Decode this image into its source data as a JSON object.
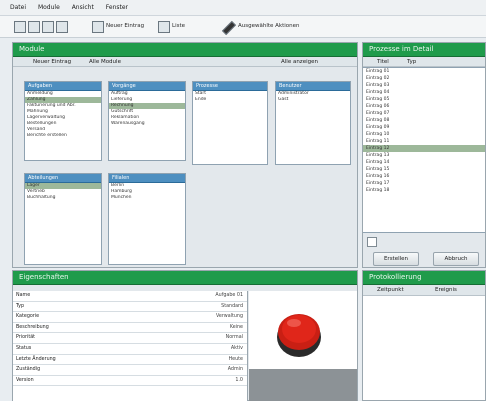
{
  "menu": [
    "Datei",
    "Module",
    "Ansicht",
    "Fenster"
  ],
  "toolbar": {
    "btn1": "Neuer Eintrag",
    "btn2": "Liste",
    "btn3": "Ausgewählte Aktionen"
  },
  "main": {
    "title": "Module",
    "tabs": [
      "Neuer Eintrag",
      "Alle Module",
      "Alle anzeigen"
    ],
    "boxes": [
      {
        "title": "Aufgaben",
        "rows": [
          "Anmeldung",
          "Zahlung",
          "Fakturierung und Abr.",
          "Mahnung",
          "Lagerverwaltung",
          "Bestellungen",
          "Versand",
          "Berichte erstellen"
        ]
      },
      {
        "title": "Vorgänge",
        "rows": [
          "Auftrag",
          "Lieferung",
          "Rechnung",
          "Gutschrift",
          "Reklamation",
          "Warenausgang"
        ]
      },
      {
        "title": "Prozesse",
        "rows": [
          "Start",
          "Ende"
        ]
      },
      {
        "title": "Benutzer",
        "rows": [
          "Administrator",
          "Gast"
        ]
      },
      {
        "title": "Abteilungen",
        "rows": [
          "Lager",
          "Vertrieb",
          "Buchhaltung"
        ]
      },
      {
        "title": "Filialen",
        "rows": [
          "Berlin",
          "Hamburg",
          "München"
        ]
      }
    ]
  },
  "right": {
    "title": "Prozesse im Detail",
    "tabs": [
      "Titel",
      "Typ"
    ],
    "items": [
      "Eintrag 01",
      "Eintrag 02",
      "Eintrag 03",
      "Eintrag 04",
      "Eintrag 05",
      "Eintrag 06",
      "Eintrag 07",
      "Eintrag 08",
      "Eintrag 09",
      "Eintrag 10",
      "Eintrag 11",
      "Eintrag 12",
      "Eintrag 13",
      "Eintrag 14",
      "Eintrag 15",
      "Eintrag 16",
      "Eintrag 17",
      "Eintrag 18"
    ],
    "btn_ok": "Erstellen",
    "btn_cancel": "Abbruch"
  },
  "bottom": {
    "title": "Eigenschaften",
    "rows": [
      {
        "label": "Name",
        "value": "Aufgabe 01"
      },
      {
        "label": "Typ",
        "value": "Standard"
      },
      {
        "label": "Kategorie",
        "value": "Verwaltung"
      },
      {
        "label": "Beschreibung",
        "value": "Keine"
      },
      {
        "label": "Priorität",
        "value": "Normal"
      },
      {
        "label": "Status",
        "value": "Aktiv"
      },
      {
        "label": "Letzte Änderung",
        "value": "Heute"
      },
      {
        "label": "Zuständig",
        "value": "Admin"
      },
      {
        "label": "Version",
        "value": "1.0"
      }
    ]
  },
  "bottom_right": {
    "title": "Protokollierung",
    "tabs": [
      "Zeitpunkt",
      "Ereignis"
    ]
  },
  "colors": {
    "accent": "#1f9b4b",
    "box_header": "#4e8fc0",
    "selection": "#9db89a",
    "stop_button": "#e0261a"
  }
}
